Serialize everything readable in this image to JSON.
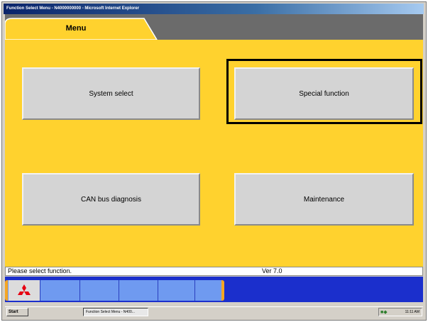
{
  "window": {
    "title": "Function Select Menu - N4000000000 - Microsoft Internet Explorer"
  },
  "tabs": [
    {
      "label": "Menu",
      "selected": true
    }
  ],
  "menu": {
    "buttons": [
      {
        "label": "System select",
        "selected": false
      },
      {
        "label": "Special function",
        "selected": true
      },
      {
        "label": "CAN bus diagnosis",
        "selected": false
      },
      {
        "label": "Maintenance",
        "selected": false
      }
    ]
  },
  "status": {
    "message": "Please select function.",
    "version": "Ver 7.0"
  },
  "app_taskbar": {
    "logo_icon": "mitsubishi-logo-icon",
    "empty_slots": 4
  },
  "win_taskbar": {
    "start_label": "Start",
    "task_label": "Function Select Menu - N400...",
    "clock": "11:11 AM"
  },
  "colors": {
    "background": "#ffd22e",
    "tab_strip": "#6b6b6b",
    "app_bar": "#1b2fcc",
    "app_bar_highlight": "#6f9af0",
    "accent_orange": "#f5a623",
    "button": "#d4d4d4",
    "logo_red": "#e60012"
  }
}
